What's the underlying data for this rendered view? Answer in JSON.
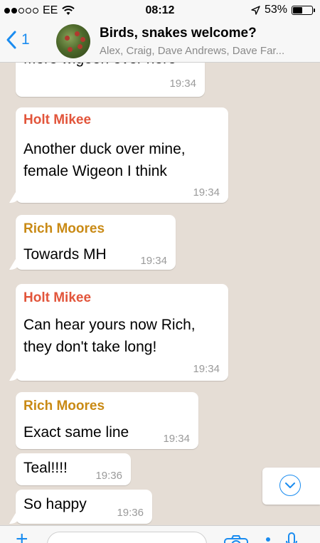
{
  "status_bar": {
    "carrier": "EE",
    "time": "08:12",
    "battery": "53%",
    "battery_level": 0.53
  },
  "header": {
    "back_count": "1",
    "title": "Birds, snakes welcome?",
    "participants": "Alex, Craig, Dave Andrews, Dave Far..."
  },
  "messages": [
    {
      "sender": "",
      "lines": [
        "More wigeon over here"
      ],
      "time": "19:34"
    },
    {
      "sender": "Holt Mikee",
      "lines": [
        "Another duck over mine,",
        "female Wigeon I think"
      ],
      "time": "19:34"
    },
    {
      "sender": "Rich Moores",
      "lines": [
        "Towards MH"
      ],
      "time": "19:34"
    },
    {
      "sender": "Holt Mikee",
      "lines": [
        "Can hear yours now Rich,",
        "they don't take long!"
      ],
      "time": "19:34"
    },
    {
      "sender": "Rich Moores",
      "lines": [
        "Exact same line"
      ],
      "time": "19:34"
    },
    {
      "sender": "",
      "lines": [
        "Teal!!!!"
      ],
      "time": "19:36"
    },
    {
      "sender": "",
      "lines": [
        "So happy"
      ],
      "time": "19:36"
    }
  ],
  "colors": {
    "accent": "#1a8cf0",
    "sender_holt": "#e2553b",
    "sender_rich": "#c98a15",
    "chat_background": "#e5ddd5"
  },
  "icons": [
    "wifi-icon",
    "location-arrow-icon",
    "back-chevron-icon",
    "scroll-down-icon",
    "plus-icon",
    "camera-icon",
    "microphone-icon"
  ]
}
